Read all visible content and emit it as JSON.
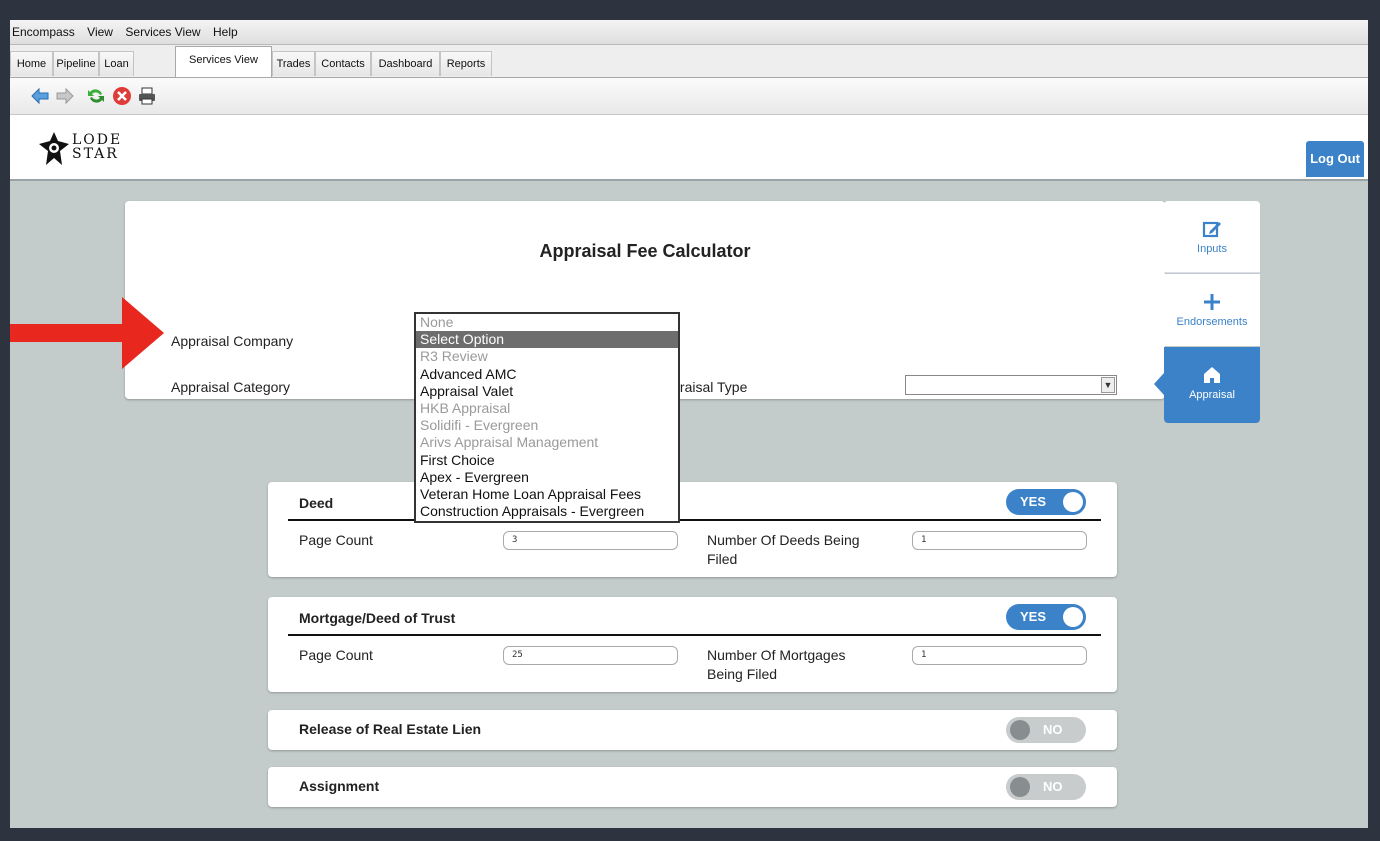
{
  "menu": [
    "Encompass",
    "View",
    "Services View",
    "Help"
  ],
  "tabs": [
    "Home",
    "Pipeline",
    "Loan",
    "Services View",
    "Trades",
    "Contacts",
    "Dashboard",
    "Reports"
  ],
  "active_tab": "Services View",
  "toolbar_icons": [
    "back-arrow-icon",
    "forward-arrow-icon",
    "refresh-icon",
    "stop-icon",
    "print-icon"
  ],
  "header": {
    "logo_line1": "LODE",
    "logo_line2": "STAR",
    "logout": "Log Out"
  },
  "calculator": {
    "title": "Appraisal Fee Calculator",
    "company_label": "Appraisal Company",
    "category_label": "Appraisal Category",
    "type_label": "Appraisal Type",
    "type_value": ""
  },
  "side_nav": [
    {
      "label": "Inputs",
      "icon": "edit-icon"
    },
    {
      "label": "Endorsements",
      "icon": "plus-icon"
    },
    {
      "label": "Appraisal",
      "icon": "home-icon"
    }
  ],
  "company_dropdown": {
    "options": [
      {
        "label": "None",
        "disabled": true
      },
      {
        "label": "Select Option",
        "selected": true
      },
      {
        "label": "R3 Review",
        "disabled": true
      },
      {
        "label": "Advanced AMC"
      },
      {
        "label": "Appraisal Valet"
      },
      {
        "label": "HKB Appraisal",
        "disabled": true
      },
      {
        "label": "Solidifi - Evergreen",
        "disabled": true
      },
      {
        "label": "Arivs Appraisal Management",
        "disabled": true
      },
      {
        "label": "First Choice"
      },
      {
        "label": "Apex - Evergreen"
      },
      {
        "label": "Veteran Home Loan Appraisal Fees"
      },
      {
        "label": "Construction Appraisals - Evergreen"
      }
    ]
  },
  "sections": {
    "deed": {
      "title": "Deed",
      "toggle": "YES",
      "page_count_label": "Page Count",
      "page_count": "3",
      "number_label_1": "Number Of Deeds Being",
      "number_label_2": "Filed",
      "number_value": "1"
    },
    "mortgage": {
      "title": "Mortgage/Deed of Trust",
      "toggle": "YES",
      "page_count_label": "Page Count",
      "page_count": "25",
      "number_label_1": "Number Of Mortgages",
      "number_label_2": "Being Filed",
      "number_value": "1"
    },
    "release": {
      "title": "Release of Real Estate Lien",
      "toggle": "NO"
    },
    "assignment": {
      "title": "Assignment",
      "toggle": "NO"
    }
  },
  "colors": {
    "accent": "#3b82c9",
    "background": "#c3cbcb",
    "annotation_arrow": "#e8281e"
  }
}
